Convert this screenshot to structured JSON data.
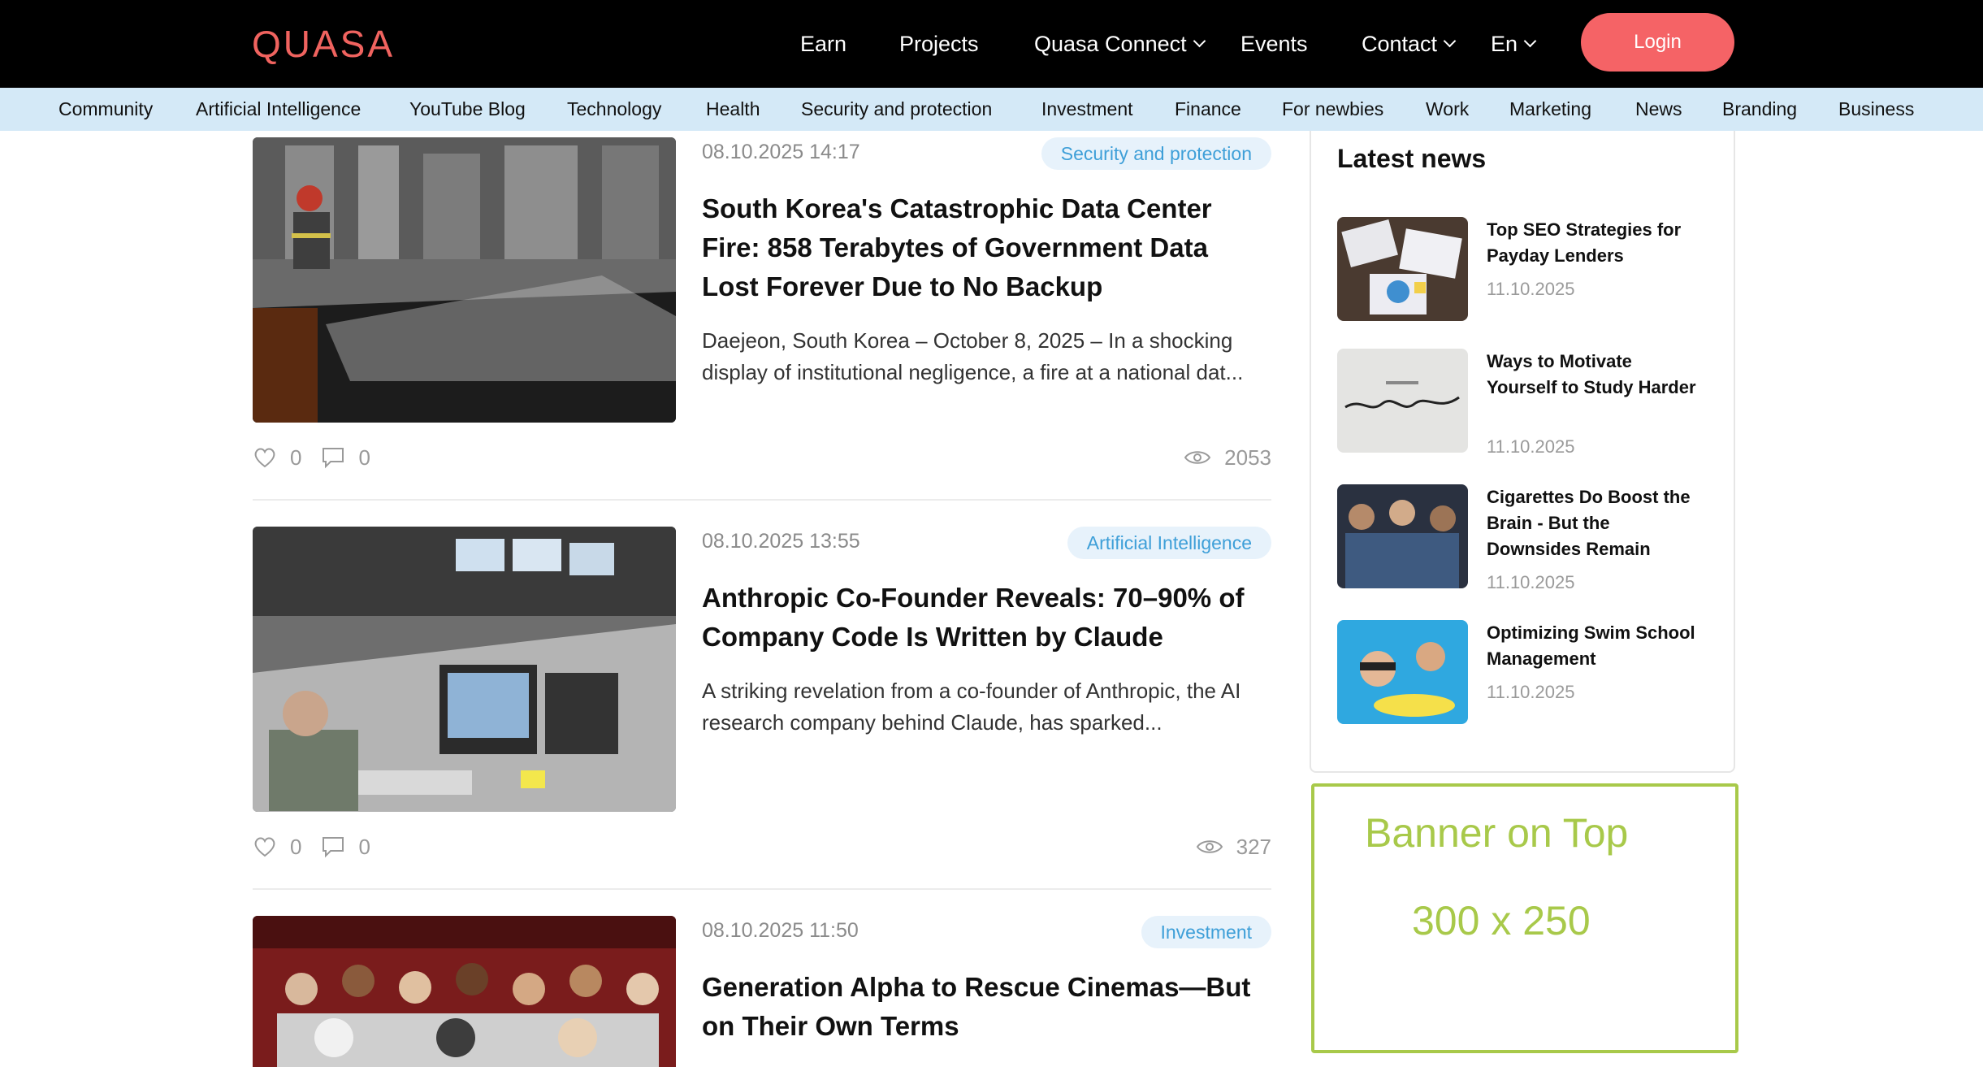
{
  "header": {
    "logo": "QUASA",
    "nav": [
      {
        "label": "Earn",
        "dropdown": false
      },
      {
        "label": "Projects",
        "dropdown": false
      },
      {
        "label": "Quasa Connect",
        "dropdown": true
      },
      {
        "label": "Events",
        "dropdown": false
      },
      {
        "label": "Contact",
        "dropdown": true
      },
      {
        "label": "En",
        "dropdown": true
      }
    ],
    "login_label": "Login"
  },
  "categories": [
    "Community",
    "Artificial Intelligence",
    "YouTube Blog",
    "Technology",
    "Health",
    "Security and protection",
    "Investment",
    "Finance",
    "For newbies",
    "Work",
    "Marketing",
    "News",
    "Branding",
    "Business"
  ],
  "articles": [
    {
      "date": "08.10.2025 14:17",
      "tag": "Security and protection",
      "title": "South Korea's Catastrophic Data Center Fire: 858 Terabytes of Government Data Lost Forever Due to No Backup",
      "excerpt": "Daejeon, South Korea – October 8, 2025 – In a shocking display of institutional negligence, a fire at a national dat...",
      "likes": "0",
      "comments": "0",
      "views": "2053"
    },
    {
      "date": "08.10.2025 13:55",
      "tag": "Artificial Intelligence",
      "title": "Anthropic Co-Founder Reveals: 70–90% of Company Code Is Written by Claude",
      "excerpt": "A striking revelation from a co-founder of Anthropic, the AI research company behind Claude, has sparked...",
      "likes": "0",
      "comments": "0",
      "views": "327"
    },
    {
      "date": "08.10.2025 11:50",
      "tag": "Investment",
      "title": "Generation Alpha to Rescue Cinemas—But on Their Own Terms"
    }
  ],
  "sidebar": {
    "title": "Latest news",
    "items": [
      {
        "title": "Top SEO Strategies for Payday Lenders",
        "date": "11.10.2025"
      },
      {
        "title": "Ways to Motivate Yourself to Study Harder",
        "date": "11.10.2025"
      },
      {
        "title": "Cigarettes Do Boost the Brain - But the Downsides Remain",
        "date": "11.10.2025"
      },
      {
        "title": "Optimizing Swim School Management",
        "date": "11.10.2025"
      }
    ]
  },
  "banner": {
    "line1": "Banner on Top",
    "line2": "300 x 250"
  },
  "colors": {
    "accent": "#f56366",
    "category_bar": "#d4e9f7",
    "tag_text": "#3e9fd8",
    "banner": "#a8c94a"
  }
}
